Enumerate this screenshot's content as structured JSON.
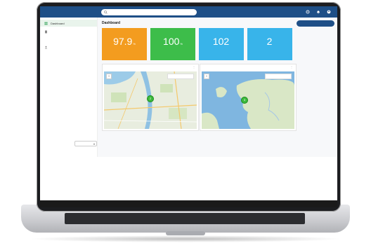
{
  "app": {
    "brand": "",
    "search_placeholder": "",
    "user_label": ""
  },
  "sidebar": {
    "items": [
      {
        "label": "Dashboard",
        "icon": "dashboard-icon"
      },
      {
        "label": "",
        "icon": "devices-icon"
      },
      {
        "label": "",
        "icon": "user-icon"
      }
    ],
    "sub_label": "",
    "footer": "",
    "select_value": ""
  },
  "main": {
    "title": "Dashboard",
    "add_button": ""
  },
  "cards": [
    {
      "title": "",
      "value": "97.9",
      "unit": "%",
      "color": "#f39c1f",
      "f1": "",
      "f2": ""
    },
    {
      "title": "",
      "value": "100",
      "unit": "%",
      "color": "#3dbd4a",
      "f1": "",
      "f2": ""
    },
    {
      "title": "",
      "value": "102",
      "unit": "",
      "color": "#38b4ea",
      "f1": "",
      "f2": ""
    },
    {
      "title": "",
      "value": "2",
      "unit": "",
      "color": "#38b4ea",
      "f1": "",
      "f2": ""
    }
  ],
  "panels": [
    {
      "title": "",
      "tool": "",
      "marker": "2",
      "kind": "land"
    },
    {
      "title": "",
      "tool": "",
      "marker": "3",
      "kind": "sea"
    }
  ]
}
